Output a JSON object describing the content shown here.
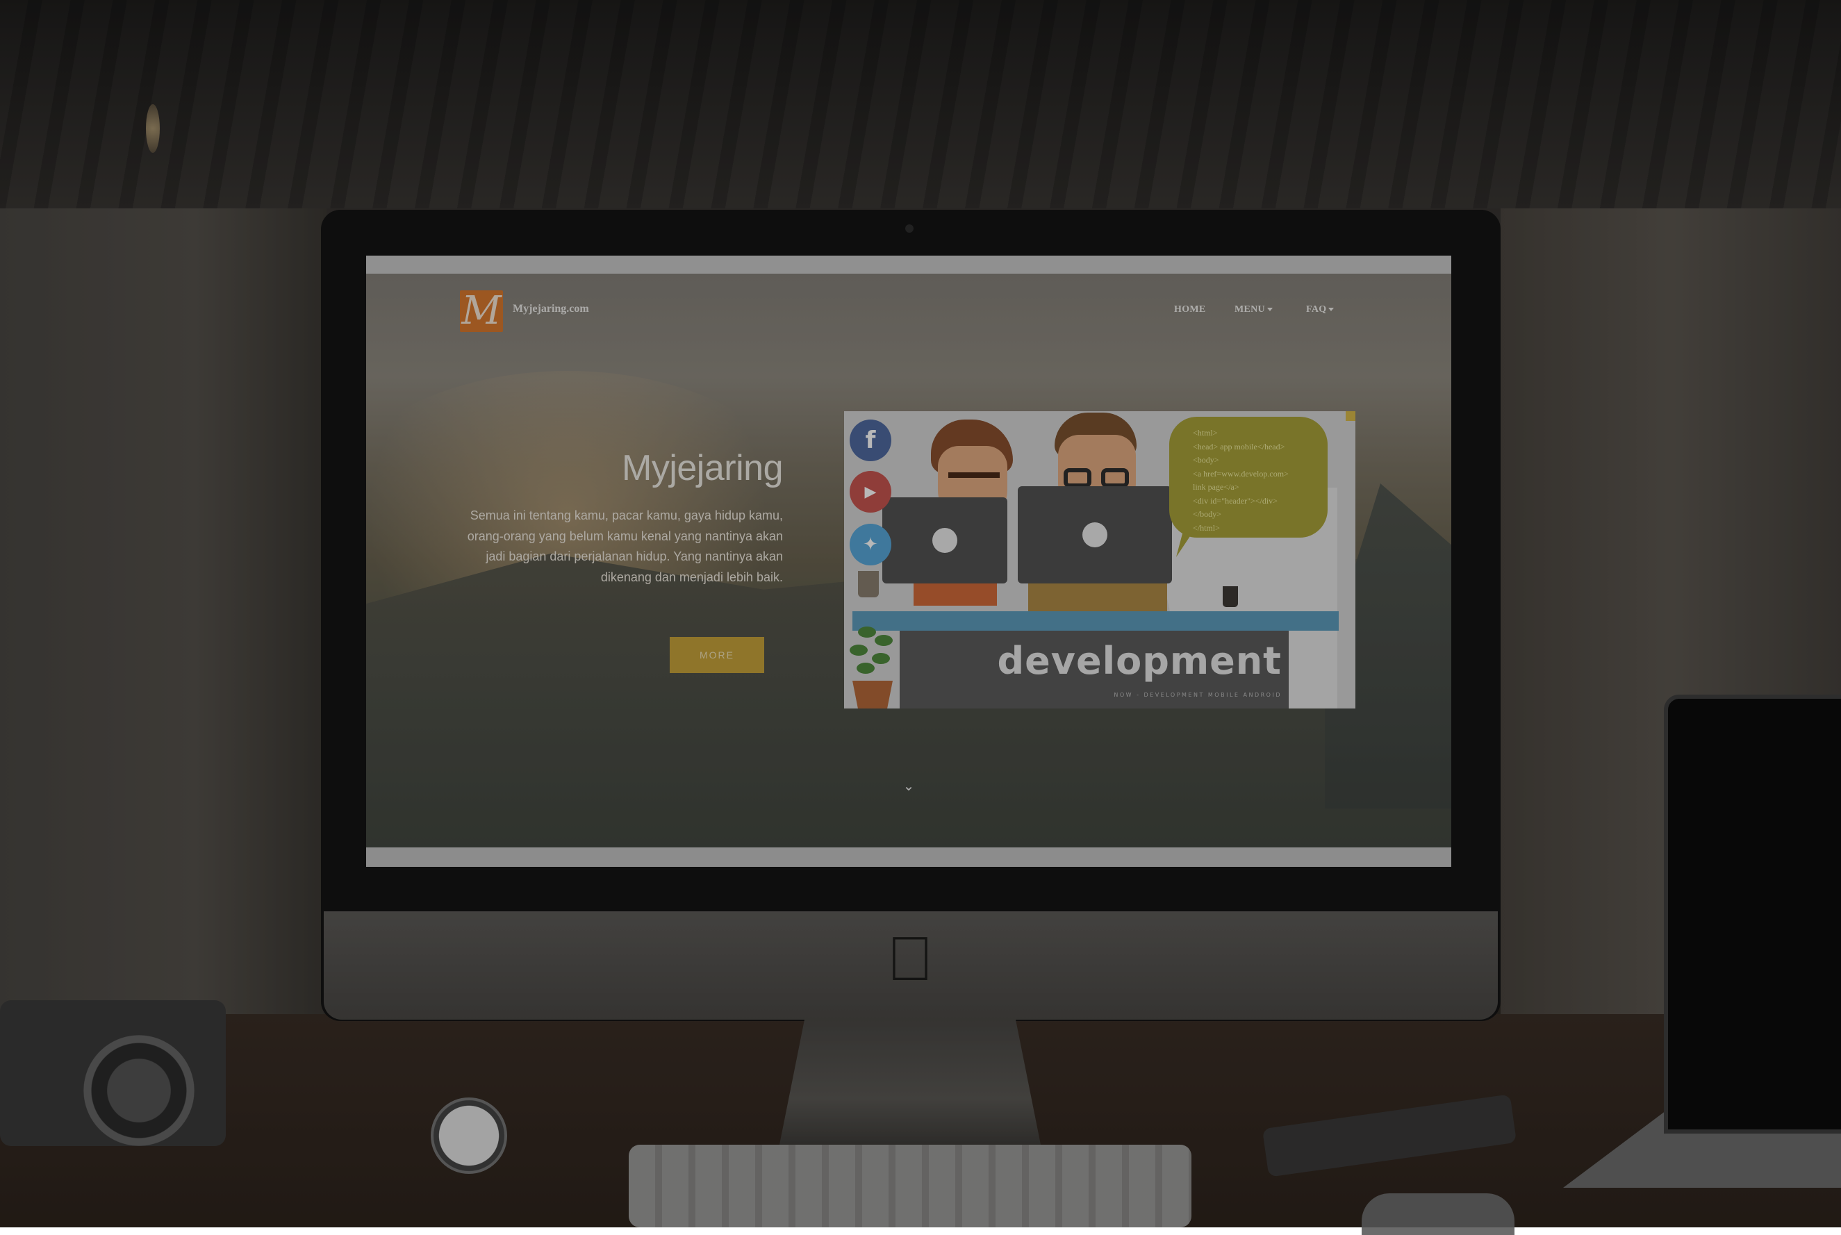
{
  "site": {
    "logo_letter": "M",
    "logo_text": "Myjejaring.com",
    "nav": {
      "home": "HOME",
      "menu": "MENU",
      "faq": "FAQ"
    }
  },
  "hero": {
    "title": "Myjejaring",
    "paragraph": "Semua ini tentang kamu, pacar kamu, gaya hidup kamu, orang-orang yang belum kamu kenal yang nantinya akan jadi bagian dari perjalanan hidup. Yang nantinya akan dikenang dan menjadi lebih baik.",
    "more_button": "MORE",
    "scroll_icon": "chevron-down-icon"
  },
  "illustration": {
    "code_lines": [
      "<html>",
      "<head> app mobile</head>",
      "<body>",
      "<a href=www.develop.com>",
      "link page</a>",
      "<div id=\"header\"></div>",
      "</body>",
      "</html>"
    ],
    "headline": "development",
    "subline": "NOW - DEVELOPMENT MOBILE ANDROID",
    "social_icons": [
      "facebook-icon",
      "youtube-icon",
      "twitter-icon"
    ]
  },
  "device": {
    "logo_icon": "apple-logo-icon"
  },
  "colors": {
    "logo_bg": "#d9792f",
    "more_button": "#c7a33b",
    "code_bubble": "#a8a13a",
    "facebook": "#4f6aa0",
    "youtube": "#c65550",
    "twitter": "#58a7d8"
  }
}
